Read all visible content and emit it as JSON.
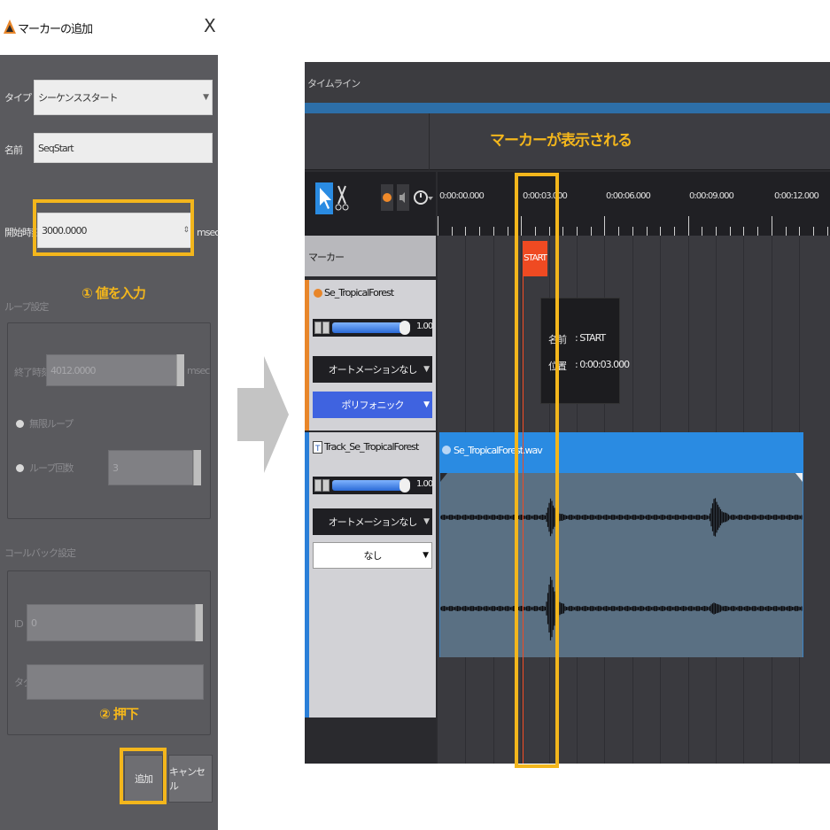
{
  "dialog": {
    "title": "マーカーの追加",
    "close_label": "X",
    "type_label": "タイプ",
    "type_value": "シーケンススタート",
    "name_label": "名前",
    "name_value": "SeqStart",
    "start_label": "開始時刻",
    "start_value": "3000.0000",
    "start_unit": "msec",
    "loop_section": "ループ設定",
    "end_label": "終了時刻",
    "end_value": "4012.0000",
    "end_unit": "msec",
    "infinite_loop": "無限ループ",
    "loop_count_label": "ループ回数",
    "loop_count_value": "3",
    "callback_section": "コールバック設定",
    "id_label": "ID",
    "id_value": "0",
    "tag_label": "タグ",
    "tag_value": "",
    "add_button": "追加",
    "cancel_button": "キャンセル"
  },
  "annotations": {
    "step1": "① 値を入力",
    "step2": "② 押下",
    "marker_shown": "マーカーが表示される"
  },
  "timeline": {
    "title": "タイムライン",
    "ruler_labels": [
      "0:00:00.000",
      "0:00:03.000",
      "0:00:06.000",
      "0:00:09.000",
      "0:00:12.000"
    ],
    "marker_row_label": "マーカー",
    "marker_flag": "START",
    "tooltip": {
      "name_label": "名前",
      "name_value": ": START",
      "position_label": "位置",
      "position_value": ": 0:00:03.000"
    },
    "track1": {
      "name": "Se_TropicalForest",
      "volume": "1.00",
      "volume_level": 0.82,
      "automation": "オートメーションなし",
      "mode": "ポリフォニック"
    },
    "track2": {
      "name": "Track_Se_TropicalForest",
      "volume": "1.00",
      "volume_level": 0.82,
      "automation": "オートメーションなし",
      "option": "なし"
    },
    "clip_name": "Se_TropicalForest.wav"
  },
  "colors": {
    "highlight": "#f3b61c",
    "marker": "#ef4a22",
    "clip_blue": "#2a8be2",
    "track_accent_orange": "#e8862a",
    "track_accent_blue": "#2a7fd8",
    "mode_button": "#3f63e0"
  }
}
